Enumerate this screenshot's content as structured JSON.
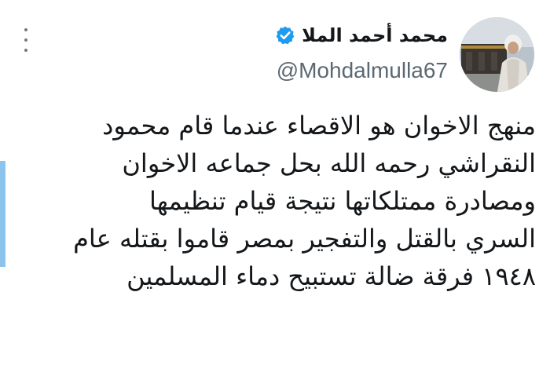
{
  "author": {
    "display_name": "محمد أحمد الملا",
    "handle": "@Mohdalmulla67",
    "verified": true
  },
  "tweet": {
    "lines": [
      "منهج الاخوان هو الاقصاء عندما قام محمود",
      "النقراشي رحمه الله بحل جماعه الاخوان",
      "ومصادرة ممتلكاتها نتيجة قيام تنظيمها",
      "السري بالقتل والتفجير بمصر قاموا بقتله عام",
      "١٩٤٨ فرقة ضالة تستبيح دماء المسلمين"
    ]
  },
  "icons": {
    "more": "more-vertical-icon",
    "verified": "verified-badge-icon"
  },
  "colors": {
    "verified_blue": "#1d9bf0",
    "text_primary": "#14171a",
    "text_secondary": "#5b6872",
    "left_accent": "#8cc4ee"
  }
}
